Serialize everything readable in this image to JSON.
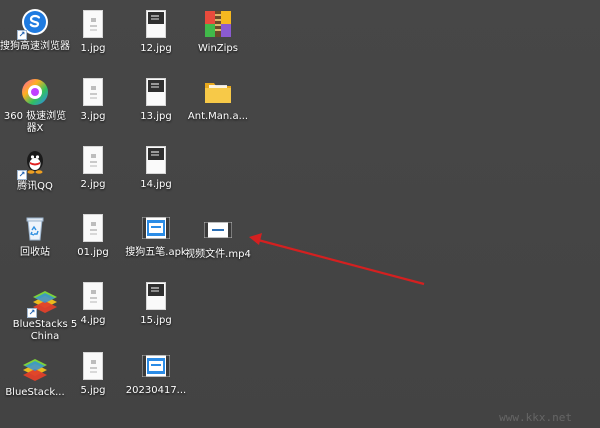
{
  "desktop": {
    "icons": [
      {
        "id": "sogou-browser",
        "label": "搜狗高速浏览器",
        "type": "app",
        "icon": "sogou-browser-icon"
      },
      {
        "id": "jpg-1",
        "label": "1.jpg",
        "type": "image",
        "icon": "image-file-icon"
      },
      {
        "id": "jpg-12",
        "label": "12.jpg",
        "type": "image",
        "icon": "image-file-icon"
      },
      {
        "id": "winzips",
        "label": "WinZips",
        "type": "app",
        "icon": "winzips-icon"
      },
      {
        "id": "360-browser",
        "label": "360 极速浏览器X",
        "type": "app",
        "icon": "360-browser-icon"
      },
      {
        "id": "jpg-3",
        "label": "3.jpg",
        "type": "image",
        "icon": "image-file-icon"
      },
      {
        "id": "jpg-13",
        "label": "13.jpg",
        "type": "image",
        "icon": "image-file-icon"
      },
      {
        "id": "antman-folder",
        "label": "Ant.Man.a...",
        "type": "folder",
        "icon": "folder-icon"
      },
      {
        "id": "qq",
        "label": "腾讯QQ",
        "type": "app",
        "icon": "qq-penguin-icon"
      },
      {
        "id": "jpg-2",
        "label": "2.jpg",
        "type": "image",
        "icon": "image-file-icon"
      },
      {
        "id": "jpg-14",
        "label": "14.jpg",
        "type": "image",
        "icon": "image-file-icon"
      },
      {
        "id": "recycle-bin",
        "label": "回收站",
        "type": "system",
        "icon": "recycle-bin-icon"
      },
      {
        "id": "jpg-01",
        "label": "01.jpg",
        "type": "image",
        "icon": "image-file-icon"
      },
      {
        "id": "sogou-wubi-apk",
        "label": "搜狗五笔.apk",
        "type": "apk",
        "icon": "video-file-icon"
      },
      {
        "id": "video-mp4",
        "label": "视频文件.mp4",
        "type": "video",
        "icon": "video-file-icon"
      },
      {
        "id": "bluestacks-5",
        "label": "BlueStacks 5 China",
        "type": "app",
        "icon": "bluestacks-icon"
      },
      {
        "id": "jpg-4",
        "label": "4.jpg",
        "type": "image",
        "icon": "image-file-icon"
      },
      {
        "id": "jpg-15",
        "label": "15.jpg",
        "type": "image",
        "icon": "image-file-icon"
      },
      {
        "id": "bluestacks-short",
        "label": "BlueStack...",
        "type": "app",
        "icon": "bluestacks-icon"
      },
      {
        "id": "jpg-5",
        "label": "5.jpg",
        "type": "image",
        "icon": "image-file-icon"
      },
      {
        "id": "file-20230417",
        "label": "20230417...",
        "type": "video",
        "icon": "video-file-icon"
      }
    ]
  },
  "annotation": {
    "arrow_color": "#d42020",
    "target": "视频文件.mp4"
  },
  "watermark": "www.kkx.net"
}
